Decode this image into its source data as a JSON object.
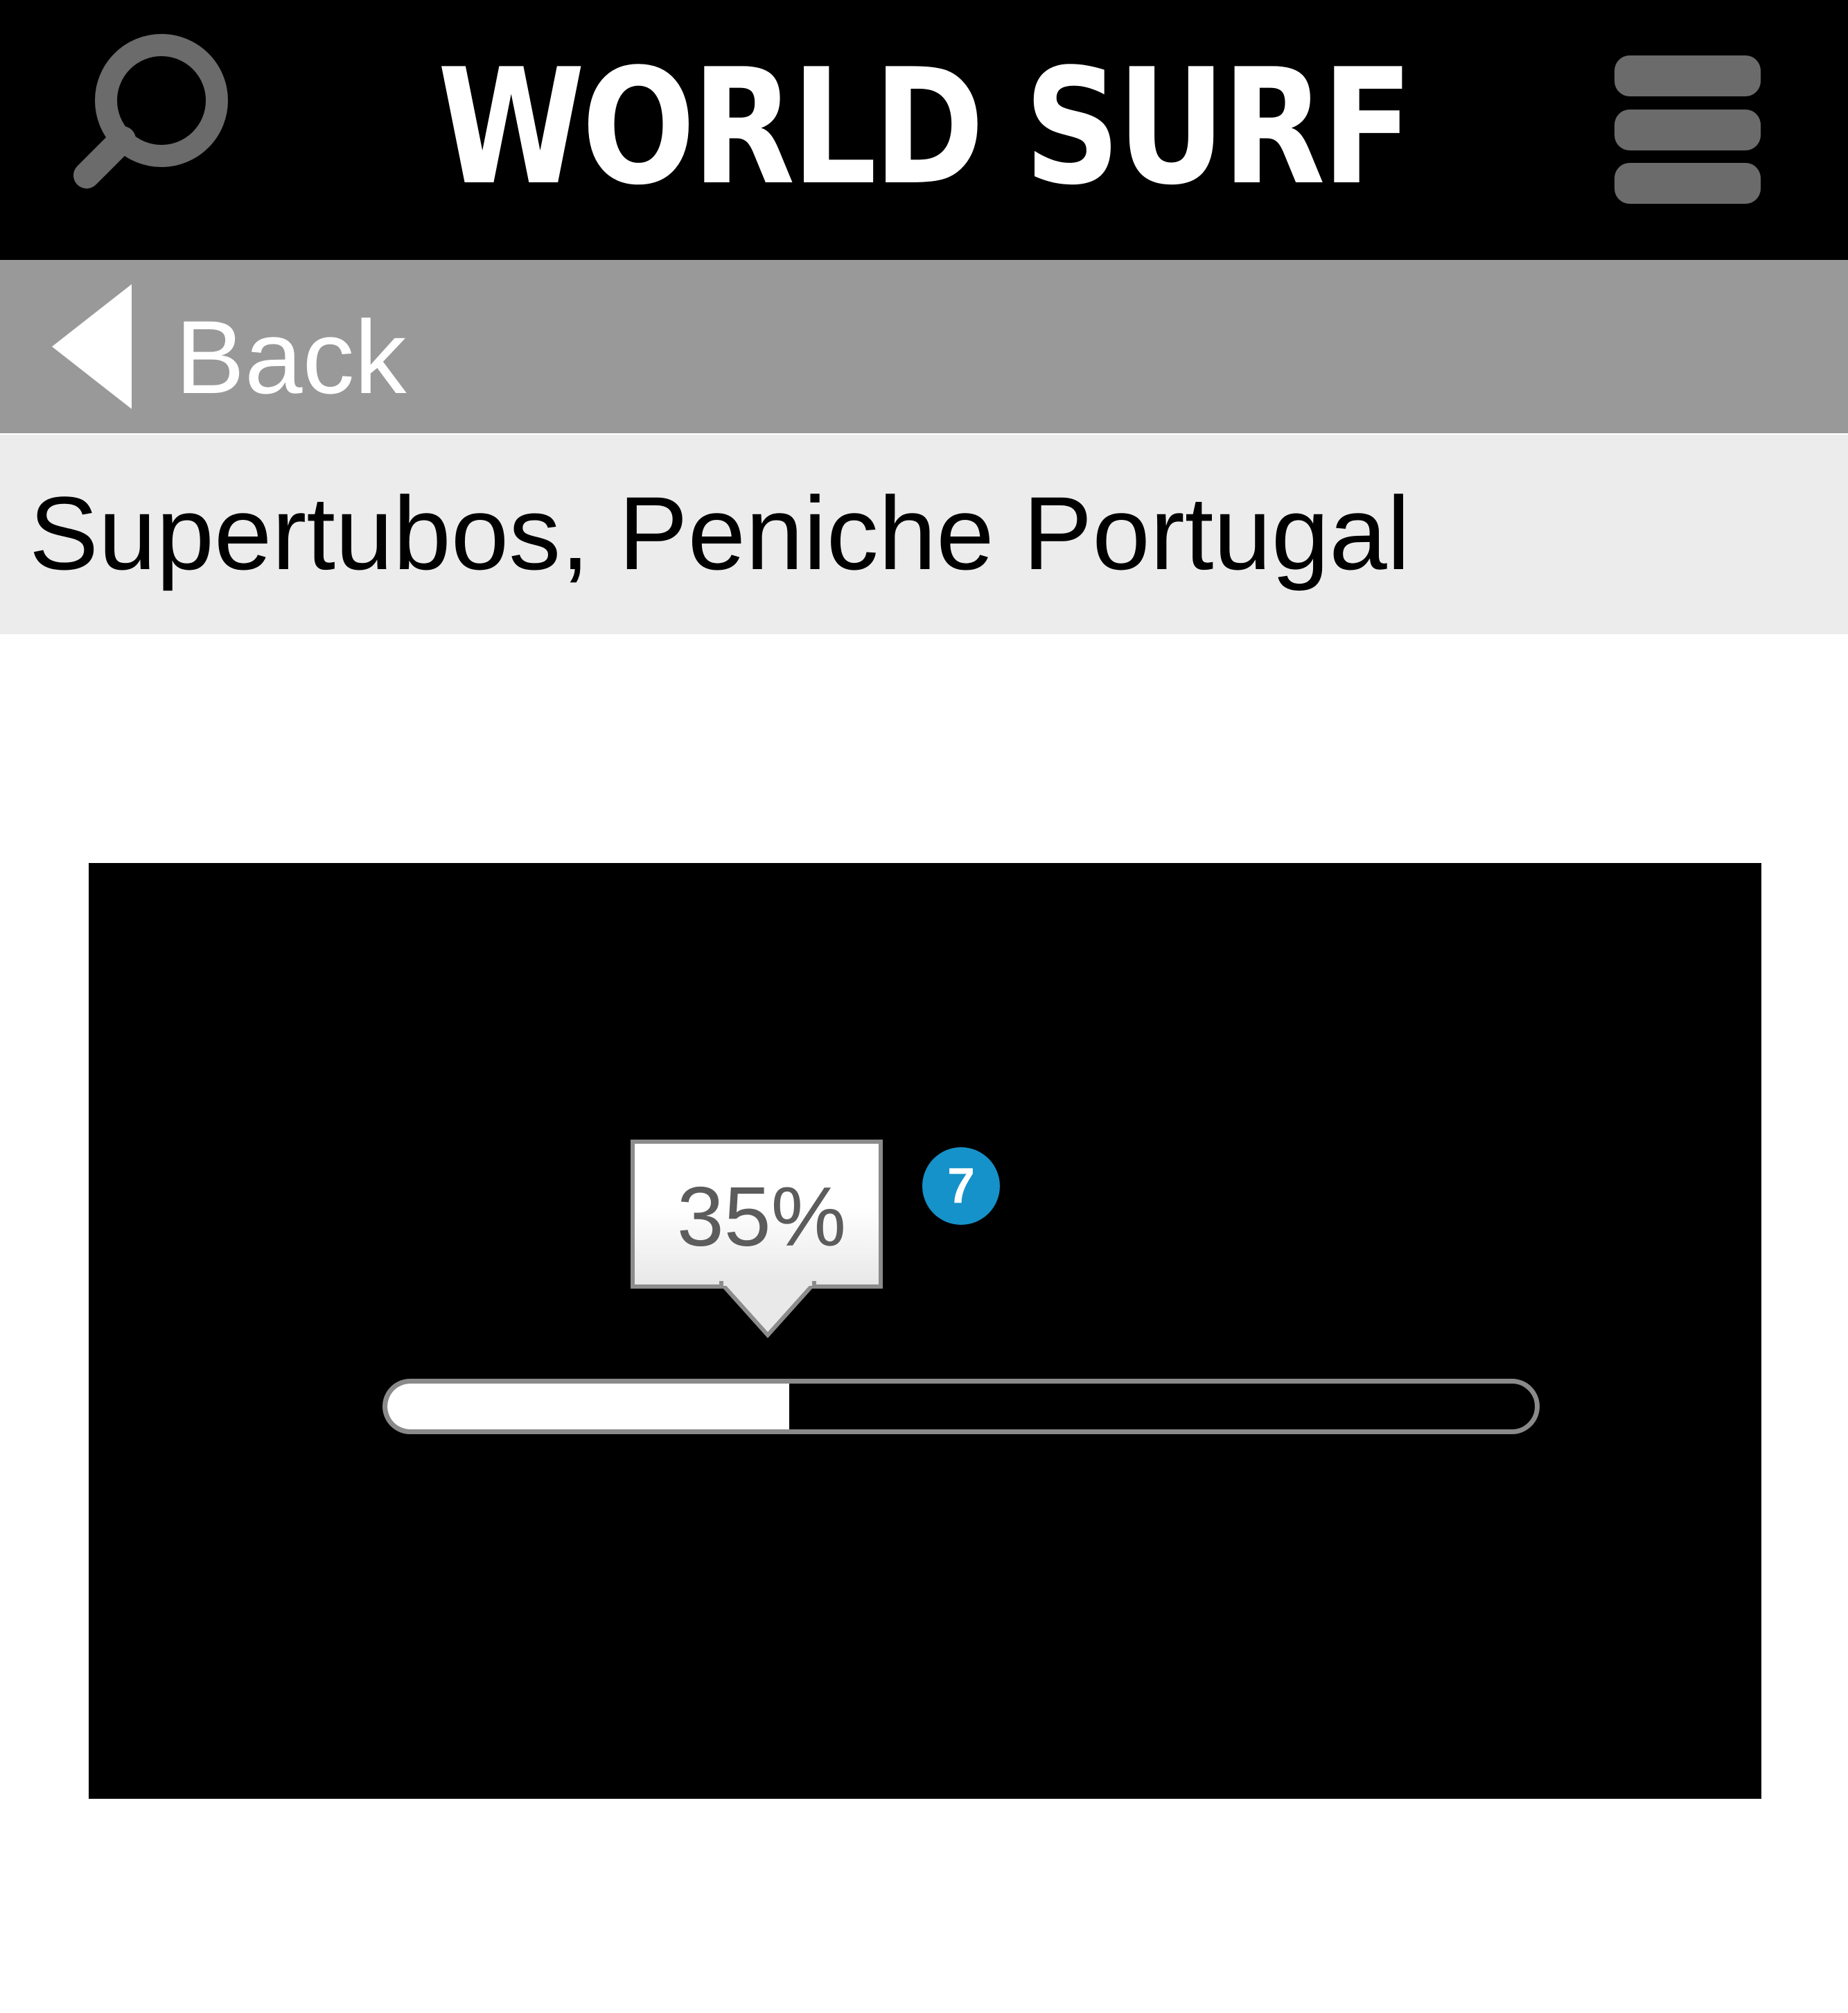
{
  "header": {
    "title": "WORLD SURF",
    "search_icon": "search-icon",
    "menu_icon": "hamburger-menu-icon"
  },
  "navigation": {
    "back_label": "Back",
    "back_icon": "triangle-left-icon"
  },
  "location": {
    "title": "Supertubos, Peniche Portugal"
  },
  "player": {
    "progress_label": "35%",
    "progress_fraction": 0.35,
    "step_badge": "7"
  },
  "colors": {
    "header_bg": "#000000",
    "back_bar_bg": "#999999",
    "location_bar_bg": "#ececec",
    "badge": "#1592c9",
    "icon_gray": "#6b6b6b"
  }
}
